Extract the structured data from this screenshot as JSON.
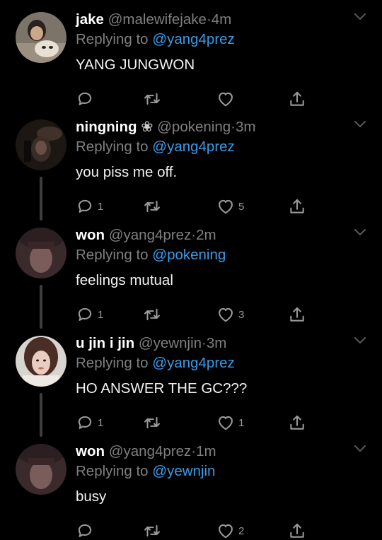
{
  "colors": {
    "background": "#000000",
    "name": "#ffffff",
    "muted": "#7f7f7f",
    "link": "#3b9be8",
    "icon": "#9a9a9a"
  },
  "icons": {
    "reply": "reply-icon",
    "retweet": "retweet-icon",
    "like": "heart-icon",
    "share": "share-icon",
    "menu": "chevron-down-icon"
  },
  "tweets": [
    {
      "name": "jake",
      "handle": "@malewifejake",
      "dot": "·",
      "time": "4m",
      "replying_label": "Replying to",
      "replying_to": "@yang4prez",
      "text": "YANG JUNGWON",
      "replies": "",
      "likes": ""
    },
    {
      "name": "ningning",
      "name_emoji": "❀",
      "handle": "@pokening",
      "dot": "·",
      "time": "3m",
      "replying_label": "Replying to",
      "replying_to": "@yang4prez",
      "text": "you piss me off.",
      "replies": "1",
      "likes": "5"
    },
    {
      "name": "won",
      "handle": "@yang4prez",
      "dot": "·",
      "time": "2m",
      "replying_label": "Replying to",
      "replying_to": "@pokening",
      "text": "feelings mutual",
      "replies": "1",
      "likes": "3"
    },
    {
      "name": "u jin i jin",
      "handle": "@yewnjin",
      "dot": "·",
      "time": "3m",
      "replying_label": "Replying to",
      "replying_to": "@yang4prez",
      "text": "HO ANSWER THE GC???",
      "replies": "1",
      "likes": "1"
    },
    {
      "name": "won",
      "handle": "@yang4prez",
      "dot": "·",
      "time": "1m",
      "replying_label": "Replying to",
      "replying_to": "@yewnjin",
      "text": "busy",
      "replies": "",
      "likes": "2"
    }
  ]
}
